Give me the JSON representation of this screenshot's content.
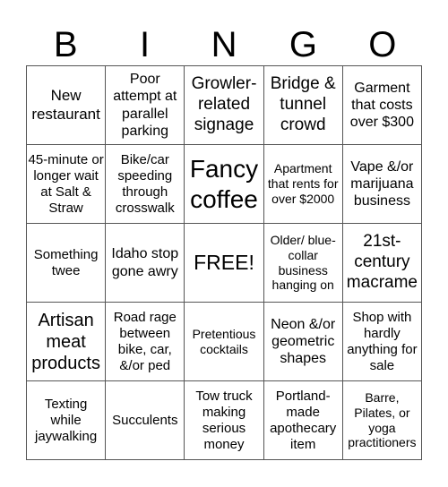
{
  "header": [
    "B",
    "I",
    "N",
    "G",
    "O"
  ],
  "cells": [
    [
      "New restaurant",
      "Poor attempt at parallel parking",
      "Growler-related signage",
      "Bridge & tunnel crowd",
      "Garment that costs over $300"
    ],
    [
      "45-minute or longer wait at Salt & Straw",
      "Bike/car speeding through crosswalk",
      "Fancy coffee",
      "Apartment that rents for over $2000",
      "Vape &/or marijuana business"
    ],
    [
      "Something twee",
      "Idaho stop gone awry",
      "FREE!",
      "Older/ blue-collar business hanging on",
      "21st-century macrame"
    ],
    [
      "Artisan meat products",
      "Road rage between bike, car, &/or ped",
      "Pretentious cocktails",
      "Neon &/or geometric shapes",
      "Shop with hardly anything for sale"
    ],
    [
      "Texting while jaywalking",
      "Succulents",
      "Tow truck making serious money",
      "Portland-made apothecary item",
      "Barre, Pilates, or yoga practitioners"
    ]
  ]
}
